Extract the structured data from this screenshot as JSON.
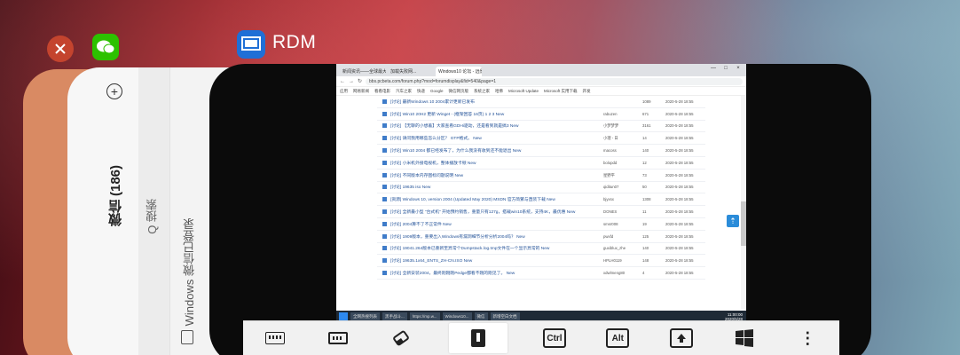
{
  "header": {
    "app_title": "RDM"
  },
  "wechat_card": {
    "title": "微信 (186)",
    "search": "Q 搜索",
    "login_status": "Windows 微信已登录",
    "plus": "+"
  },
  "browser": {
    "tabs": [
      "新闻资讯——全球最大的中文IT门户",
      "加载失败网...",
      "Windows10 论坛 - 远景论坛"
    ],
    "url": "bbs.pcbeta.com/forum.php?mod=forumdisplay&fid=540&page=1",
    "bookmarks": [
      "应用",
      "网易新闻",
      "看看电影",
      "汽车之家",
      "快递",
      "Google",
      "微信网页版",
      "系统之家",
      "哈佛",
      "Microsoft Update",
      "Microsoft 实用下载",
      "开发"
    ],
    "rows": [
      {
        "title": "[讨论] 最新Windows 10 2004累计更新已发布",
        "author": "",
        "count": "1089",
        "last": "2020-5-28 18:55"
      },
      {
        "title": "[讨论] Win10 20H2 更新 Winget - (框架回答 16页) 1 2 3 New",
        "author": "rabuzen",
        "count": "671",
        "last": "2020-5-28 18:55"
      },
      {
        "title": "[讨论] 【无聊的小想着】大家查看GDHi驱动，还是看到就是搞3 New",
        "author": "小梦梦梦",
        "count": "3161",
        "last": "2020-5-28 18:55"
      },
      {
        "title": "[讨论] 请问我用哪些怎么分区？ GTP格式。 New",
        "author": "小理 - 日",
        "count": "14",
        "last": "2020-5-28 18:55"
      },
      {
        "title": "[讨论] Win10 2004 都已经发布了，为什么我没有收到还不能退出 New",
        "author": "macoss",
        "count": "140",
        "last": "2020-5-28 18:55"
      },
      {
        "title": "[讨论] 小米机外接电视机，整体播放卡顿 New",
        "author": "bolopdd",
        "count": "12",
        "last": "2020-5-28 18:55"
      },
      {
        "title": "[讨论] 不同版本内存图标问题说明 New",
        "author": "星野平",
        "count": "73",
        "last": "2020-5-28 18:55"
      },
      {
        "title": "[讨论] 19635 iso New",
        "author": "qiditun07",
        "count": "50",
        "last": "2020-5-28 18:55"
      },
      {
        "title": "[资源] Windows 10, version 2004 (Updated May 2020) MSDN 官方简繁与直装下载 New",
        "author": "bjyxsx",
        "count": "1308",
        "last": "2020-5-28 18:55"
      },
      {
        "title": "[讨论] 全新最小型 \"台式机\" 开始预约销售，重量只有127g，搭载win10系统，支持4K，最优惠 New",
        "author": "DONES",
        "count": "11",
        "last": "2020-5-28 18:55"
      },
      {
        "title": "[讨论] 2004算不了不正常件 New",
        "author": "smsr008",
        "count": "19",
        "last": "2020-5-28 18:55"
      },
      {
        "title": "[讨论] 1909版本，重要出入Windows有漏洞细节分析分析2004吗？ New",
        "author": "pwxfd",
        "count": "125",
        "last": "2020-5-28 18:55"
      },
      {
        "title": "[讨论] 19041.264版本已重新至异常个Dumpstack.log.tmp文件在一个显示异常的 New",
        "author": "guxiblux_zhe",
        "count": "140",
        "last": "2020-5-28 18:55"
      },
      {
        "title": "[讨论] 19635.1x64_ENTS_ZH-CN.ISO New",
        "author": "HPLH0119",
        "count": "148",
        "last": "2020-5-28 18:55"
      },
      {
        "title": "[讨论] 全新安装2004，最终刚刚刚Pedge都看不刚的刚见了。 New",
        "author": "xdwlmeng80",
        "count": "4",
        "last": "2020-5-28 18:55"
      }
    ],
    "taskbar": [
      "全网热搜列表",
      "黑手战斗...",
      "https://mp.w...",
      "Windows10...",
      "微信",
      "新增空白文档"
    ],
    "clock_time": "11:00:00",
    "clock_date": "2020/5/28",
    "window_controls": [
      "—",
      "□",
      "×"
    ]
  },
  "toolbar": {
    "items": [
      {
        "name": "keyboard",
        "label": ""
      },
      {
        "name": "keyboard-fn",
        "label": ""
      },
      {
        "name": "eraser",
        "label": ""
      },
      {
        "name": "touch-mode",
        "label": ""
      },
      {
        "name": "ctrl",
        "label": "Ctrl"
      },
      {
        "name": "alt",
        "label": "Alt"
      },
      {
        "name": "shift",
        "label": ""
      },
      {
        "name": "windows",
        "label": ""
      },
      {
        "name": "more",
        "label": "⋮"
      }
    ]
  }
}
